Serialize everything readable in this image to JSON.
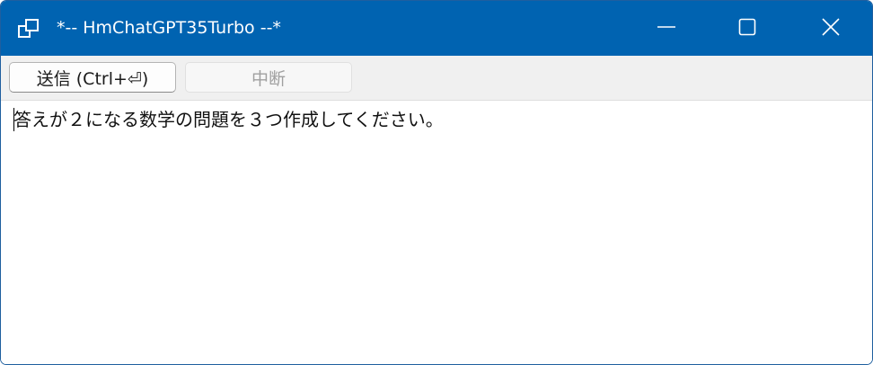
{
  "window": {
    "title": "*-- HmChatGPT35Turbo --*",
    "app_icon": "window-switch-icon",
    "controls": {
      "minimize_icon": "minimize-icon",
      "maximize_icon": "maximize-icon",
      "close_icon": "close-icon"
    },
    "titlebar_color": "#0063b1"
  },
  "toolbar": {
    "send_label": "送信 (Ctrl+⏎)",
    "stop_label": "中断"
  },
  "editor": {
    "text": "答えが２になる数学の問題を３つ作成してください。"
  }
}
